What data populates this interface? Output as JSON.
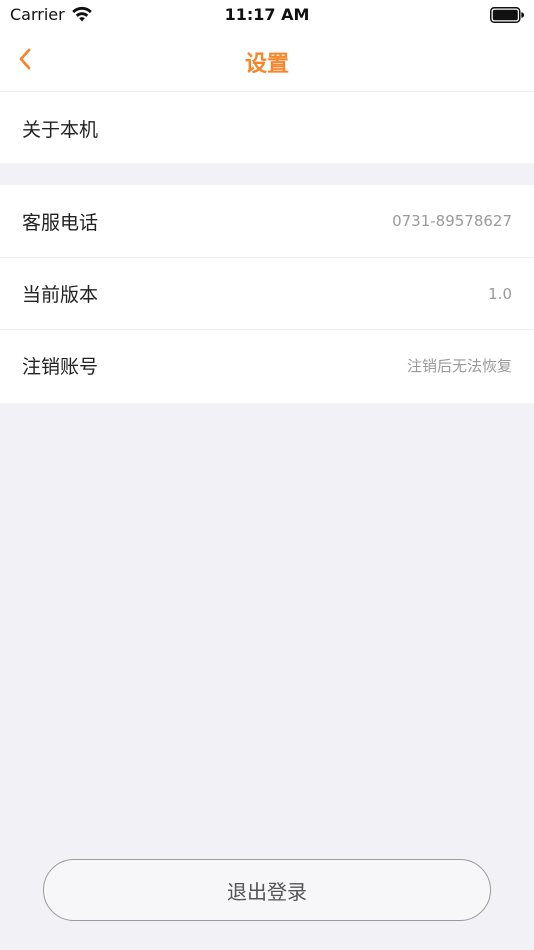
{
  "status_bar": {
    "carrier": "Carrier",
    "time": "11:17 AM",
    "wifi_icon": "wifi-icon",
    "battery_icon": "battery-full-icon"
  },
  "nav": {
    "title": "设置",
    "back_icon": "chevron-left-icon",
    "accent_color": "#f7862b"
  },
  "groups": [
    {
      "rows": [
        {
          "label": "关于本机",
          "value": ""
        }
      ]
    },
    {
      "rows": [
        {
          "label": "客服电话",
          "value": "0731-89578627"
        },
        {
          "label": "当前版本",
          "value": "1.0"
        },
        {
          "label": "注销账号",
          "value": "注销后无法恢复"
        }
      ]
    }
  ],
  "logout": {
    "label": "退出登录"
  }
}
